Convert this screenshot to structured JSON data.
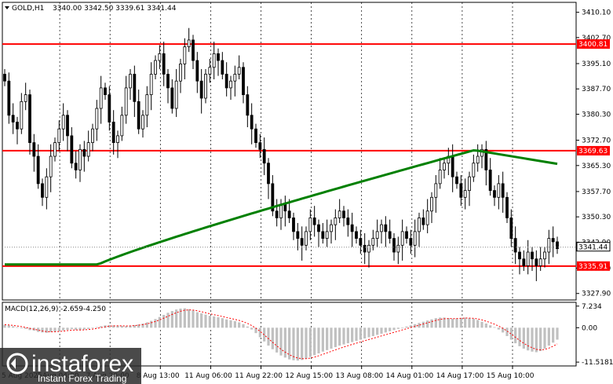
{
  "header": {
    "symbol": "GOLD,H1",
    "ohlc": "3340.00 3342.50 3339.61 3341.44"
  },
  "chart_data": {
    "type": "candlestick",
    "symbol": "GOLD,H1",
    "price_axis": {
      "ticks": [
        "3410.10",
        "3402.70",
        "3395.10",
        "3387.70",
        "3380.30",
        "3372.70",
        "3365.30",
        "3357.70",
        "3350.30",
        "3342.90",
        "3335.30",
        "3327.90"
      ],
      "range": [
        3326,
        3413
      ]
    },
    "time_axis": {
      "labels": [
        "5 Aug 2025",
        "7 Aug 04:00",
        "7 Aug 20:00",
        "8 Aug 13:00",
        "11 Aug 06:00",
        "11 Aug 22:00",
        "12 Aug 15:00",
        "13 Aug 08:00",
        "14 Aug 01:00",
        "14 Aug 17:00",
        "15 Aug 10:00"
      ]
    },
    "levels": [
      {
        "value": 3400.81,
        "label": "3400.81",
        "color": "#ff0000"
      },
      {
        "value": 3369.63,
        "label": "3369.63",
        "color": "#ff0000"
      },
      {
        "value": 3335.91,
        "label": "3335.91",
        "color": "#ff0000"
      }
    ],
    "current_price": {
      "value": 3341.44,
      "label": "3341.44"
    },
    "close_series": [
      3390,
      3380,
      3378,
      3376,
      3384,
      3386,
      3372,
      3368,
      3360,
      3356,
      3362,
      3368,
      3372,
      3376,
      3380,
      3374,
      3366,
      3364,
      3370,
      3368,
      3372,
      3376,
      3382,
      3388,
      3386,
      3378,
      3372,
      3374,
      3380,
      3388,
      3392,
      3384,
      3376,
      3380,
      3386,
      3392,
      3396,
      3398,
      3392,
      3388,
      3382,
      3390,
      3395,
      3400,
      3402,
      3396,
      3390,
      3385,
      3392,
      3394,
      3398,
      3396,
      3392,
      3388,
      3390,
      3392,
      3394,
      3386,
      3380,
      3376,
      3372,
      3370,
      3366,
      3360,
      3352,
      3350,
      3354,
      3352,
      3350,
      3346,
      3344,
      3342,
      3346,
      3350,
      3348,
      3346,
      3344,
      3346,
      3348,
      3350,
      3352,
      3350,
      3348,
      3346,
      3344,
      3342,
      3340,
      3342,
      3344,
      3346,
      3348,
      3346,
      3344,
      3340,
      3342,
      3346,
      3344,
      3342,
      3346,
      3350,
      3348,
      3352,
      3356,
      3360,
      3364,
      3366,
      3368,
      3362,
      3360,
      3356,
      3358,
      3362,
      3366,
      3368,
      3370,
      3364,
      3358,
      3356,
      3360,
      3356,
      3350,
      3344,
      3340,
      3338,
      3336,
      3340,
      3338,
      3336,
      3338,
      3340,
      3344,
      3343,
      3341
    ],
    "ma200": {
      "color": "#008000",
      "start": 3336.4,
      "end": 3365.8
    },
    "macd": {
      "label": "MACD(12,26,9)",
      "macd_value": "-2.659",
      "signal_value": "-4.250",
      "ticks": [
        "7.234",
        "0.00",
        "-11.5181"
      ],
      "range": [
        -12.8,
        8.5
      ],
      "histogram": [
        1.0,
        0.8,
        0.5,
        0.2,
        0.0,
        -0.4,
        -0.8,
        -1.0,
        -1.4,
        -1.6,
        -1.7,
        -1.5,
        -1.3,
        -1.1,
        -0.9,
        -0.7,
        -0.5,
        -0.7,
        -0.8,
        -0.6,
        -0.4,
        -0.2,
        0.2,
        0.5,
        0.8,
        0.9,
        0.8,
        0.7,
        0.6,
        0.5,
        0.7,
        0.9,
        1.1,
        1.4,
        1.8,
        2.3,
        2.9,
        3.6,
        4.3,
        5.0,
        5.6,
        6.1,
        6.4,
        6.5,
        6.2,
        5.8,
        5.2,
        4.8,
        4.4,
        4.0,
        3.8,
        3.5,
        3.2,
        2.8,
        2.5,
        2.2,
        1.8,
        1.2,
        0.4,
        -0.6,
        -1.8,
        -3.2,
        -4.6,
        -6.0,
        -7.2,
        -8.3,
        -9.3,
        -10.0,
        -10.6,
        -10.9,
        -11.0,
        -10.8,
        -10.4,
        -9.8,
        -9.2,
        -8.6,
        -8.0,
        -7.5,
        -7.0,
        -6.5,
        -6.0,
        -5.6,
        -5.2,
        -4.8,
        -4.4,
        -4.0,
        -3.6,
        -3.2,
        -2.8,
        -2.4,
        -2.0,
        -1.6,
        -1.2,
        -0.8,
        -0.4,
        0.0,
        0.4,
        0.8,
        1.2,
        1.6,
        2.0,
        2.4,
        2.8,
        3.2,
        3.4,
        3.4,
        3.2,
        3.0,
        3.1,
        3.3,
        3.4,
        3.2,
        3.0,
        2.6,
        2.0,
        1.4,
        0.8,
        0.2,
        -0.6,
        -1.6,
        -2.8,
        -4.0,
        -5.2,
        -6.2,
        -7.0,
        -7.6,
        -8.0,
        -8.2,
        -7.8,
        -7.0,
        -6.0,
        -5.0,
        -4.0
      ]
    }
  },
  "watermark": {
    "brand": "instaforex",
    "tagline": "Instant Forex Trading"
  },
  "colors": {
    "background": "#ffffff",
    "candle": "#000000",
    "level": "#ff0000",
    "ma": "#008000",
    "macd_hist": "#c0c0c0",
    "macd_signal": "#ff0000",
    "watermark_bg": "#2a2a2a"
  }
}
